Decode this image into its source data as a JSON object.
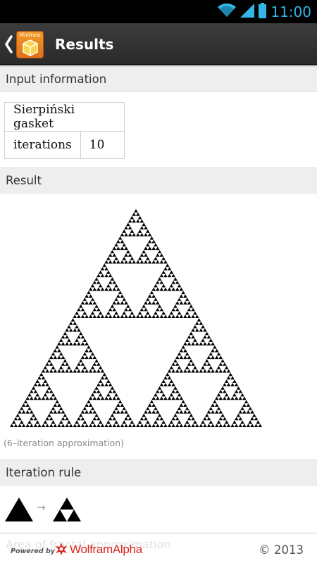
{
  "status_bar": {
    "time": "11:00",
    "icons": [
      "wifi-icon",
      "signal-icon",
      "battery-icon"
    ]
  },
  "action_bar": {
    "title": "Results",
    "logo_text": "Wolfram",
    "back_icon": "chevron-left-icon"
  },
  "pods": {
    "input_information": {
      "title": "Input information",
      "table": {
        "header": "Sierpiński gasket",
        "rows": [
          {
            "label": "iterations",
            "value": "10"
          }
        ]
      }
    },
    "result": {
      "title": "Result",
      "image": "sierpinski-gasket",
      "caption": "(6–iteration approximation)"
    },
    "iteration_rule": {
      "title": "Iteration rule",
      "arrow": "→"
    }
  },
  "footer": {
    "obscured_header": "Area of fractal approximation",
    "powered_by": "Powered by",
    "brand": "WolframAlpha",
    "copyright": "© 2013"
  },
  "colors": {
    "status_time": "#33b5e5",
    "action_bar": "#333333",
    "brand_red": "#d7271d",
    "pod_header_bg": "#eeeeee"
  }
}
